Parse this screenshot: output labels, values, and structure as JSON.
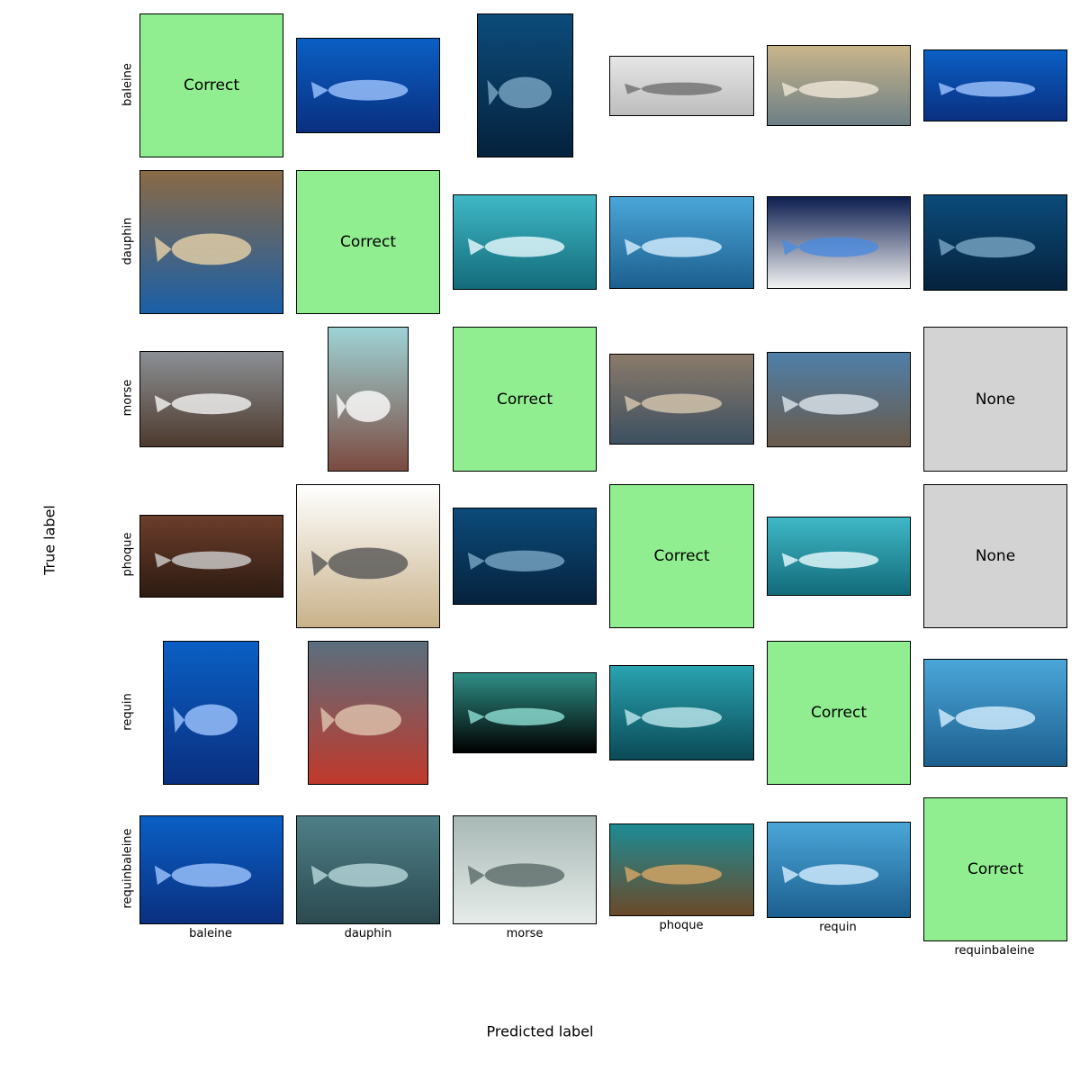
{
  "chart_data": {
    "type": "image-grid",
    "xlabel": "Predicted label",
    "ylabel": "True label",
    "row_labels": [
      "baleine",
      "dauphin",
      "morse",
      "phoque",
      "requin",
      "requinbaleine"
    ],
    "col_labels": [
      "baleine",
      "dauphin",
      "morse",
      "phoque",
      "requin",
      "requinbaleine"
    ],
    "cells": [
      [
        "Correct",
        "image",
        "image",
        "image",
        "image",
        "image"
      ],
      [
        "image",
        "Correct",
        "image",
        "image",
        "image",
        "image"
      ],
      [
        "image",
        "image",
        "Correct",
        "image",
        "image",
        "None"
      ],
      [
        "image",
        "image",
        "image",
        "Correct",
        "image",
        "None"
      ],
      [
        "image",
        "image",
        "image",
        "image",
        "Correct",
        "image"
      ],
      [
        "image",
        "image",
        "image",
        "image",
        "image",
        "Correct"
      ]
    ],
    "colors": {
      "correct": "#90ee90",
      "none": "#d3d3d3"
    }
  },
  "image_themes": [
    [
      "",
      "underwater-blue",
      "underwater-deep",
      "grey-studio",
      "beach",
      "underwater-blue"
    ],
    [
      "interior-room",
      "",
      "aquarium-teal",
      "water-surface",
      "dark-poster",
      "underwater-deep"
    ],
    [
      "snow-photo",
      "cartoon-mountain",
      "",
      "rocky-shore",
      "arctic-shore",
      ""
    ],
    [
      "ocean-rock",
      "white-background",
      "underwater-deep",
      "",
      "aquarium-teal",
      ""
    ],
    [
      "underwater-blue",
      "boat-photo",
      "dark-aquarium",
      "underwater-teal",
      "",
      "water-surface"
    ],
    [
      "underwater-blue",
      "shark-skin",
      "pale-closeup",
      "sea-floor",
      "water-surface",
      ""
    ]
  ]
}
